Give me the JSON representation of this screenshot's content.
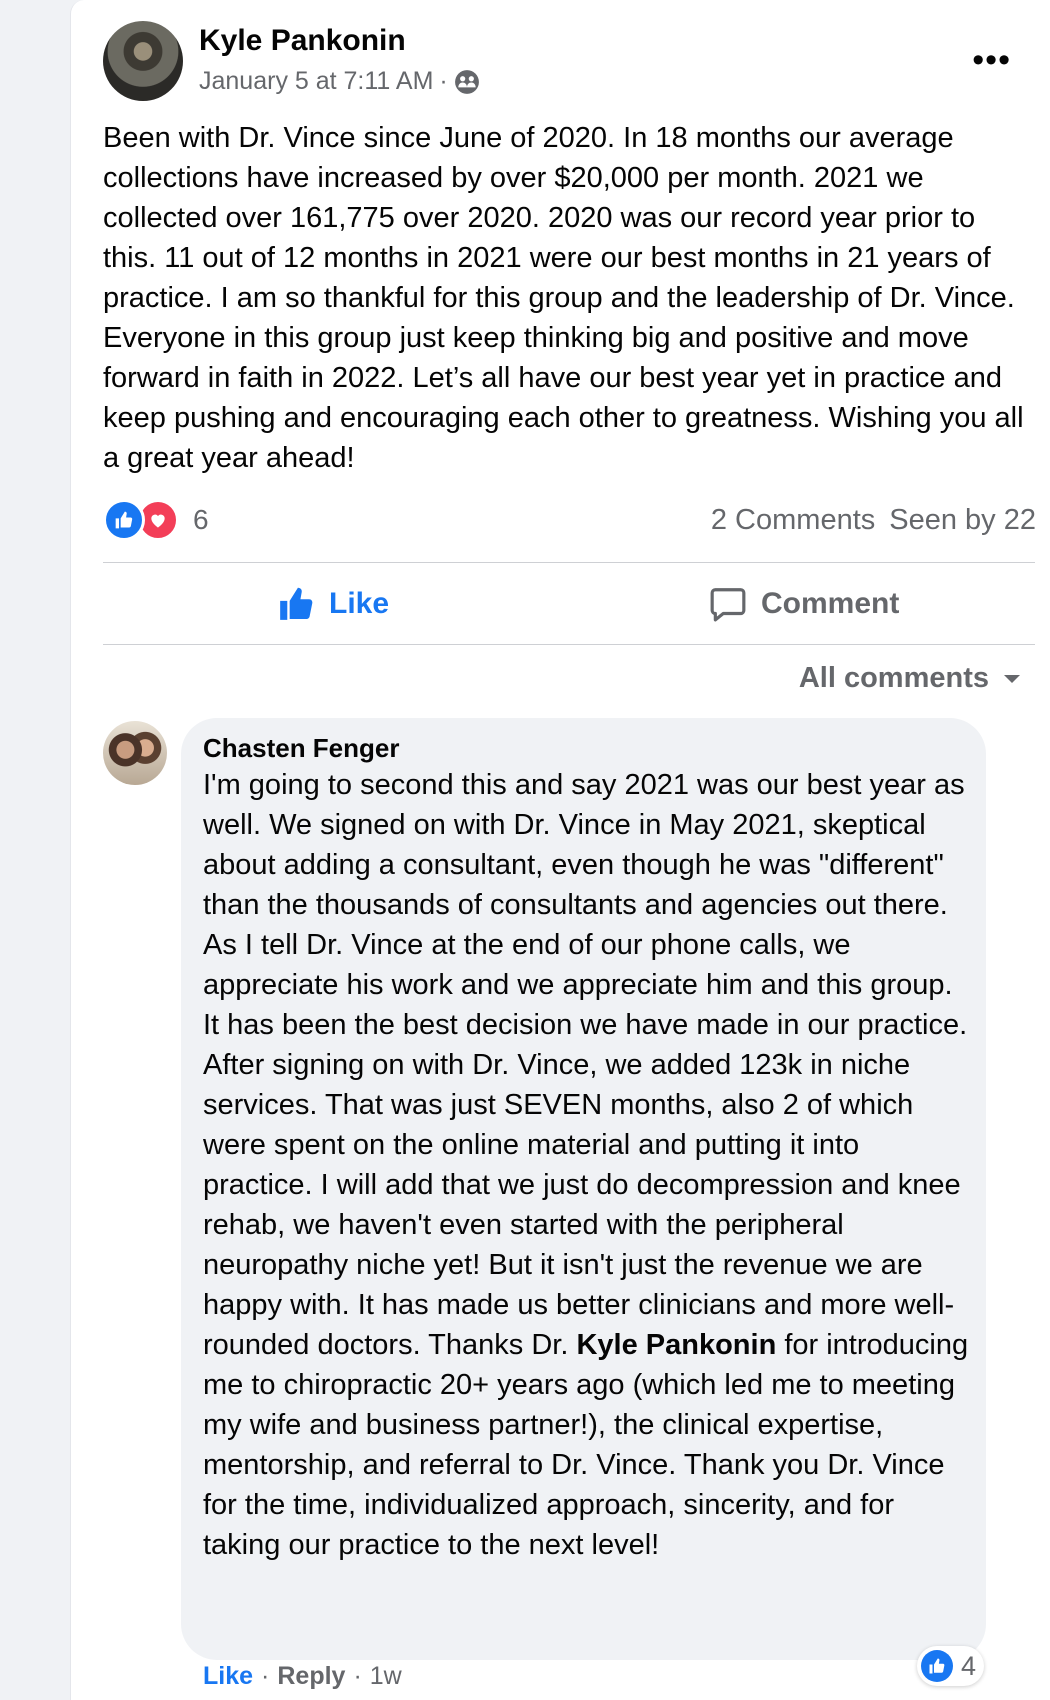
{
  "post": {
    "author": "Kyle Pankonin",
    "timestamp": "January 5 at 7:11 AM",
    "separator": "·",
    "privacy_icon": "group-icon",
    "more_label": "•••",
    "text": "Been with Dr. Vince since June of 2020. In 18 months our average collections have increased by over $20,000 per month. 2021 we collected over 161,775 over 2020. 2020 was our record year prior to this. 11 out of 12 months in 2021 were our best months in 21 years of practice. I am so thankful for this group and the leadership of Dr. Vince. Everyone in this group just keep thinking big and positive and move forward in faith in 2022. Let’s all have our best year yet in practice and keep pushing and encouraging each other to greatness. Wishing you all a great year ahead!",
    "reactions": {
      "count": "6",
      "types": [
        "like",
        "love"
      ]
    },
    "comments_count": "2 Comments",
    "seen_by": "Seen by 22"
  },
  "actions": {
    "like_label": "Like",
    "comment_label": "Comment"
  },
  "comments_filter": {
    "label": "All comments"
  },
  "comment": {
    "author": "Chasten Fenger",
    "text_before": "I'm going to second this and say 2021 was our best year as well. We signed on with Dr. Vince in May 2021, skeptical about adding a consultant, even though he was \"different\" than the thousands of consultants and agencies out there. As I tell Dr. Vince at the end of our phone calls, we appreciate his work and we appreciate him and this group. It has been the best decision we have made in our practice. After signing on with Dr. Vince, we added 123k in niche services. That was just SEVEN months, also 2 of which were spent on the online material and putting it into practice. I will add that we just do decompression and knee rehab, we haven't even started with the peripheral neuropathy niche yet! But it isn't just the revenue we are happy with. It has made us better clinicians and more well-rounded doctors. Thanks Dr. ",
    "mention": "Kyle Pankonin",
    "text_after": " for introducing me to chiropractic 20+ years ago (which led me to meeting my wife and business partner!), the clinical expertise, mentorship, and referral to Dr. Vince. Thank you Dr. Vince for the time, individualized approach, sincerity, and for taking our practice to the next level!",
    "reaction_count": "4",
    "like_label": "Like",
    "reply_label": "Reply",
    "age": "1w",
    "separator": "·"
  },
  "colors": {
    "accent": "#1877f2",
    "love": "#f33e58",
    "secondary_text": "#65676b",
    "bubble": "#f0f2f5"
  }
}
